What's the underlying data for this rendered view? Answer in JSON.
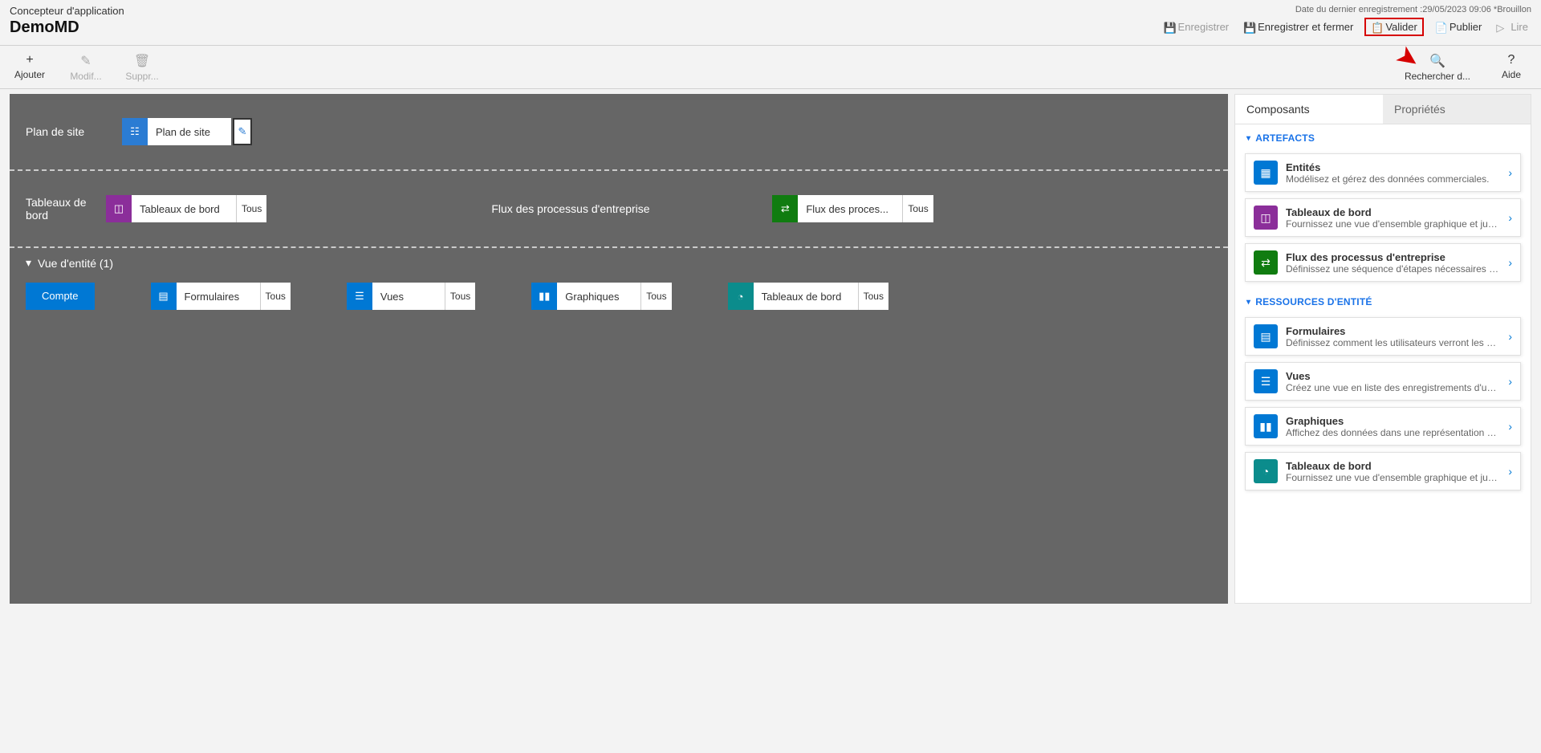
{
  "header": {
    "subtitle": "Concepteur d'application",
    "title": "DemoMD",
    "lastSaved": "Date du dernier enregistrement :29/05/2023 09:06 *Brouillon",
    "actions": {
      "save": "Enregistrer",
      "saveClose": "Enregistrer et fermer",
      "validate": "Valider",
      "publish": "Publier",
      "read": "Lire"
    }
  },
  "cmdbar": {
    "add": "Ajouter",
    "edit": "Modif...",
    "delete": "Suppr...",
    "search": "Rechercher d...",
    "help": "Aide"
  },
  "canvas": {
    "sitemapLabel": "Plan de site",
    "sitemapTile": "Plan de site",
    "dashboardsLabel": "Tableaux de bord",
    "dashboardsTile": "Tableaux de bord",
    "dashboardsCount": "Tous",
    "bpfLabel": "Flux des processus d'entreprise",
    "bpfTile": "Flux des proces...",
    "bpfCount": "Tous",
    "entityHeader": "Vue d'entité (1)",
    "entity": {
      "name": "Compte",
      "forms": "Formulaires",
      "views": "Vues",
      "charts": "Graphiques",
      "dashboards": "Tableaux de bord",
      "all": "Tous"
    }
  },
  "sidebar": {
    "tabs": {
      "components": "Composants",
      "properties": "Propriétés"
    },
    "sections": {
      "artifacts": "ARTEFACTS",
      "entityResources": "RESSOURCES D'ENTITÉ"
    },
    "artifacts": [
      {
        "title": "Entités",
        "desc": "Modélisez et gérez des données commerciales."
      },
      {
        "title": "Tableaux de bord",
        "desc": "Fournissez une vue d'ensemble graphique et judic..."
      },
      {
        "title": "Flux des processus d'entreprise",
        "desc": "Définissez une séquence d'étapes nécessaires pou..."
      }
    ],
    "entityResources": [
      {
        "title": "Formulaires",
        "desc": "Définissez comment les utilisateurs verront les do..."
      },
      {
        "title": "Vues",
        "desc": "Créez une vue en liste des enregistrements d'une ..."
      },
      {
        "title": "Graphiques",
        "desc": "Affichez des données dans une représentation vis..."
      },
      {
        "title": "Tableaux de bord",
        "desc": "Fournissez une vue d'ensemble graphique et judic..."
      }
    ]
  }
}
